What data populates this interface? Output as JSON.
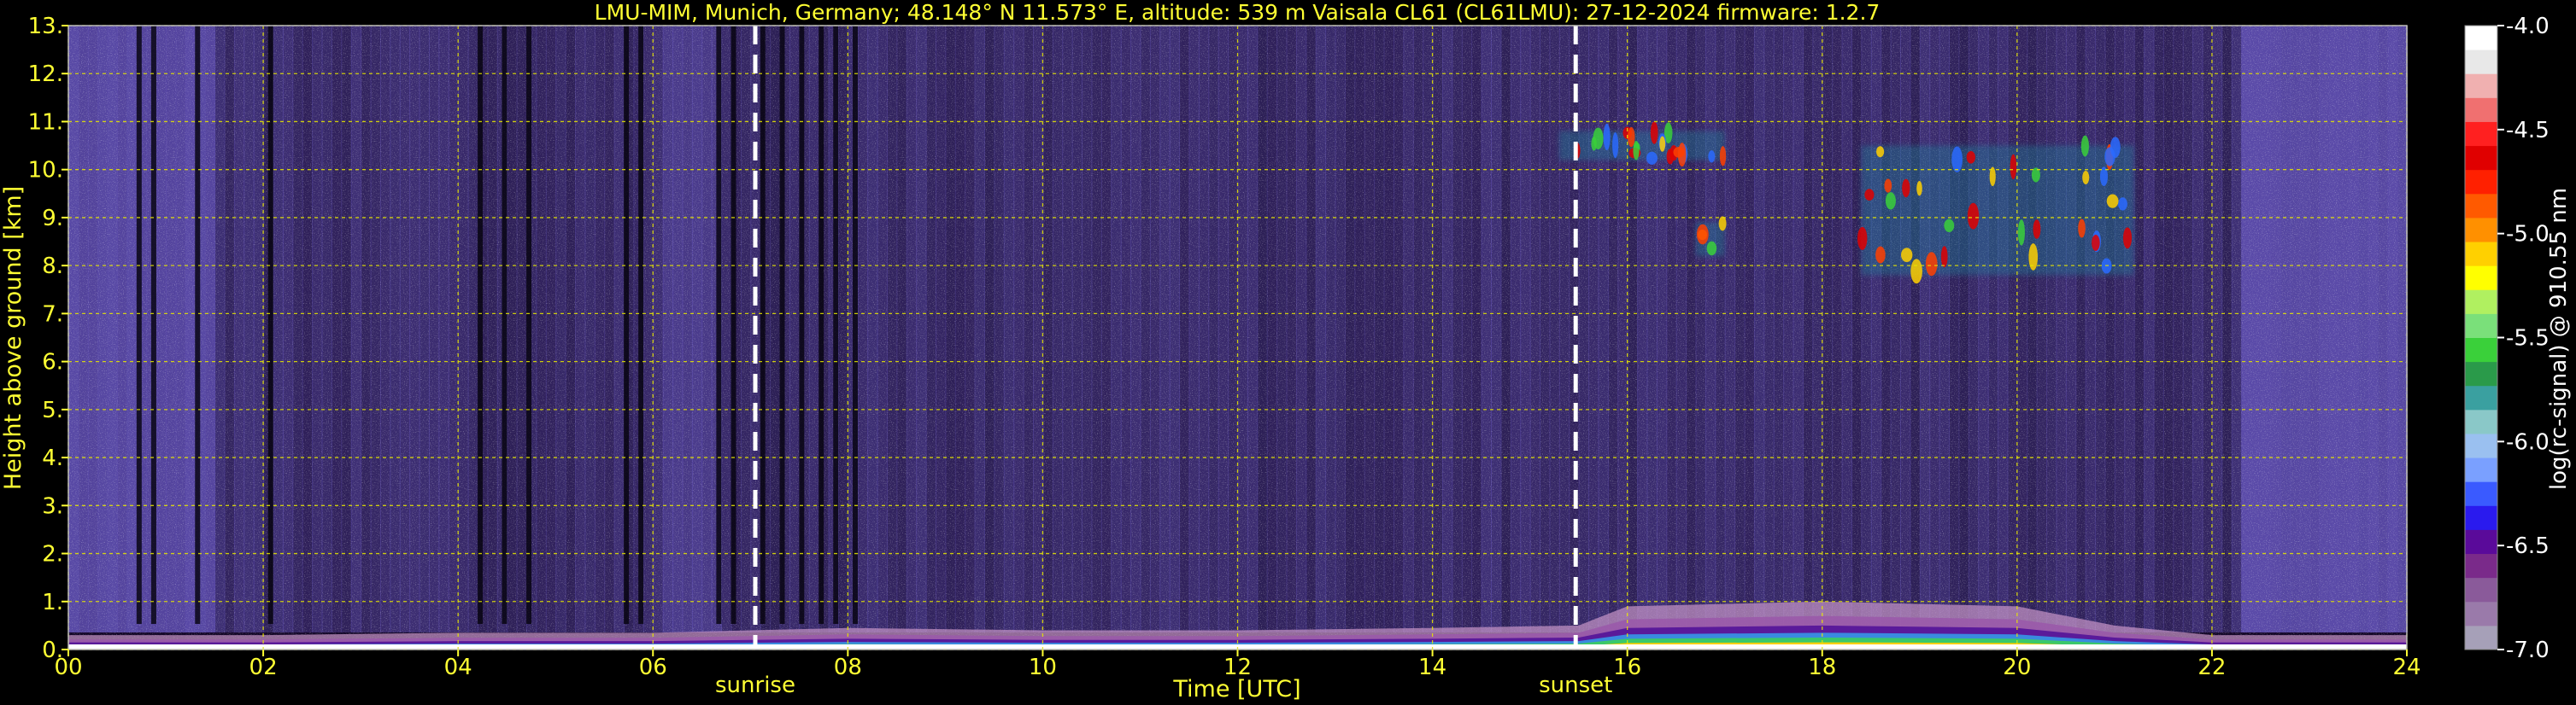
{
  "chart_data": {
    "type": "heatmap",
    "title": "LMU-MIM, Munich, Germany; 48.148° N 11.573° E, altitude: 539 m    Vaisala CL61 (CL61LMU): 27-12-2024    firmware: 1.2.7",
    "xlabel": "Time [UTC]",
    "ylabel": "Height above ground [km]",
    "colorbar_label": "log(rc-signal) @ 910.55 nm",
    "xlim": [
      0,
      24
    ],
    "ylim": [
      0,
      13
    ],
    "clim": [
      -7.0,
      -4.0
    ],
    "x_ticks": [
      "00",
      "02",
      "04",
      "06",
      "08",
      "10",
      "12",
      "14",
      "16",
      "18",
      "20",
      "22",
      "24"
    ],
    "y_ticks": [
      "0.",
      "1.",
      "2.",
      "3.",
      "4.",
      "5.",
      "6.",
      "7.",
      "8.",
      "9.",
      "10.",
      "11.",
      "12.",
      "13."
    ],
    "colorbar_ticks": [
      "-4.0",
      "-4.5",
      "-5.0",
      "-5.5",
      "-6.0",
      "-6.5",
      "-7.0"
    ],
    "grid": true,
    "annotations": [
      {
        "label": "sunrise",
        "time": 7.05
      },
      {
        "label": "sunset",
        "time": 15.47
      }
    ],
    "features": {
      "boundary_layer_top_km": [
        [
          0,
          0.3
        ],
        [
          2,
          0.3
        ],
        [
          4,
          0.35
        ],
        [
          6,
          0.35
        ],
        [
          7,
          0.4
        ],
        [
          8,
          0.45
        ],
        [
          10,
          0.4
        ],
        [
          12,
          0.4
        ],
        [
          14,
          0.45
        ],
        [
          15.5,
          0.5
        ],
        [
          16,
          0.9
        ],
        [
          18,
          1.0
        ],
        [
          20,
          0.9
        ],
        [
          21,
          0.5
        ],
        [
          22,
          0.3
        ],
        [
          24,
          0.3
        ]
      ],
      "cirrus": [
        {
          "t_start": 15.3,
          "t_end": 17.0,
          "base_km": 10.2,
          "top_km": 10.8
        },
        {
          "t_start": 16.7,
          "t_end": 17.0,
          "base_km": 8.2,
          "top_km": 8.9
        },
        {
          "t_start": 18.4,
          "t_end": 21.2,
          "base_km": 7.8,
          "top_km": 10.5
        }
      ]
    },
    "colormap": [
      "#a6a0b8",
      "#9a7aaa",
      "#8a5a9a",
      "#7a2a8a",
      "#5a0a9a",
      "#2a1aee",
      "#3a5aff",
      "#7aa0ff",
      "#9ac0f0",
      "#8ac8c8",
      "#3aa0a0",
      "#2a9a4a",
      "#3ad03a",
      "#7ae07a",
      "#b0f060",
      "#ffff00",
      "#ffd000",
      "#ff9000",
      "#ff5a00",
      "#ff2000",
      "#e00000",
      "#ff2020",
      "#f07070",
      "#f0b0b0",
      "#e8e8e8",
      "#ffffff"
    ]
  }
}
